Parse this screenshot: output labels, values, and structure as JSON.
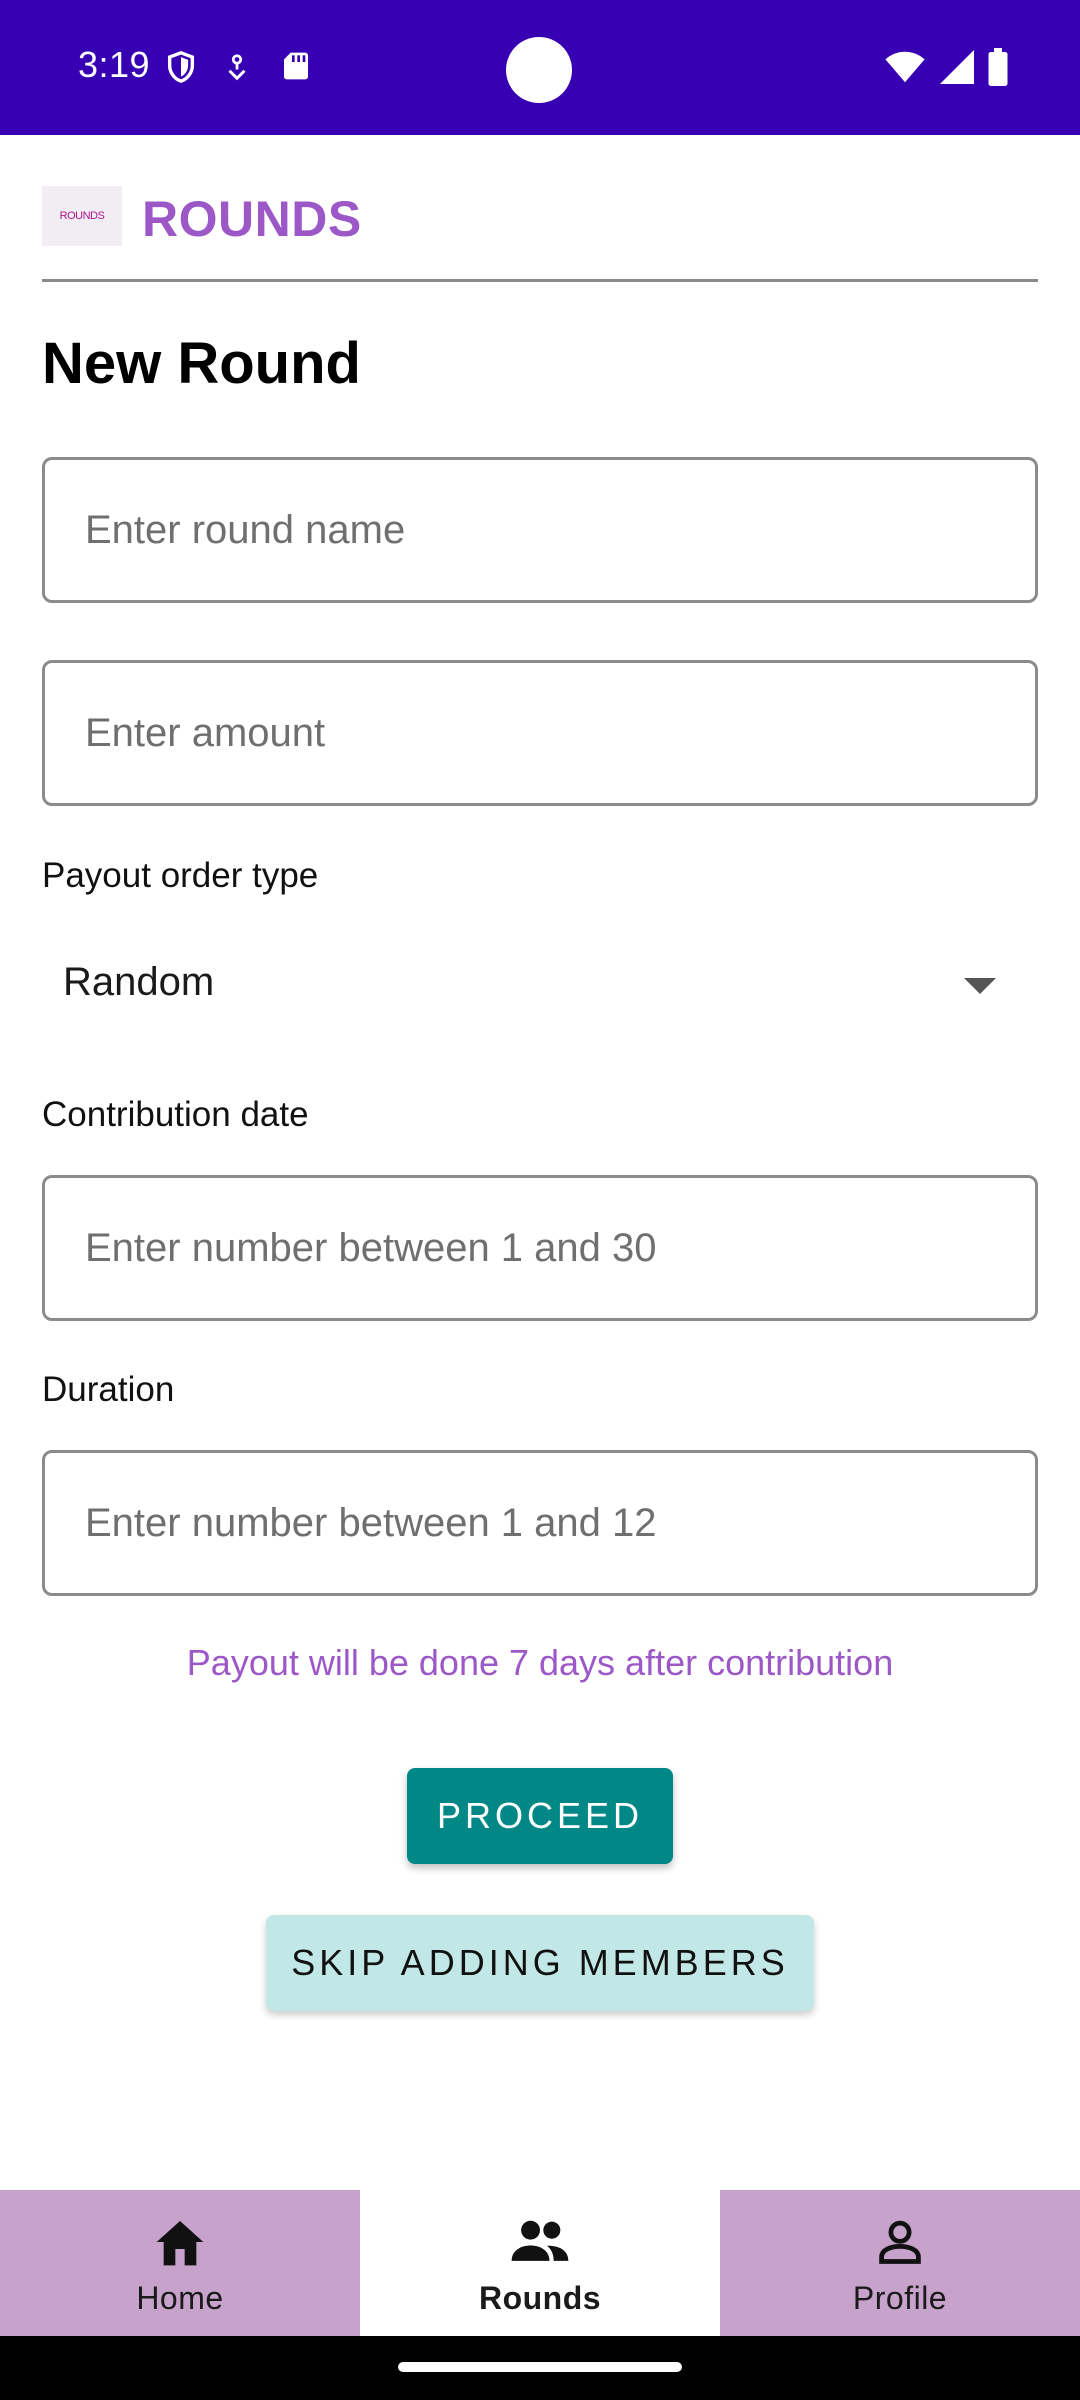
{
  "status_bar": {
    "time": "3:19",
    "left_icons": [
      "shield-icon",
      "vpn-key-icon",
      "sd-card-icon"
    ],
    "right_icons": [
      "wifi-icon",
      "signal-icon",
      "battery-icon"
    ],
    "background": "#3700b3"
  },
  "header": {
    "logo_text": "ROUNDS",
    "title": "ROUNDS",
    "title_color": "#9d58c8"
  },
  "page": {
    "title": "New Round"
  },
  "form": {
    "round_name_placeholder": "Enter round name",
    "amount_placeholder": "Enter amount",
    "payout_order_label": "Payout order type",
    "payout_order_value": "Random",
    "contribution_date_label": "Contribution date",
    "contribution_date_placeholder": "Enter number between 1 and 30",
    "duration_label": "Duration",
    "duration_placeholder": "Enter number between 1 and 12",
    "payout_note": "Payout will be done 7 days after contribution"
  },
  "buttons": {
    "proceed": "PROCEED",
    "skip": "SKIP ADDING MEMBERS",
    "proceed_color": "#018786",
    "skip_color": "#c1e8e6"
  },
  "bottom_nav": {
    "items": [
      {
        "label": "Home",
        "icon": "home-icon",
        "active": false
      },
      {
        "label": "Rounds",
        "icon": "group-icon",
        "active": true
      },
      {
        "label": "Profile",
        "icon": "person-icon",
        "active": false
      }
    ],
    "background": "#c7a2cb"
  }
}
